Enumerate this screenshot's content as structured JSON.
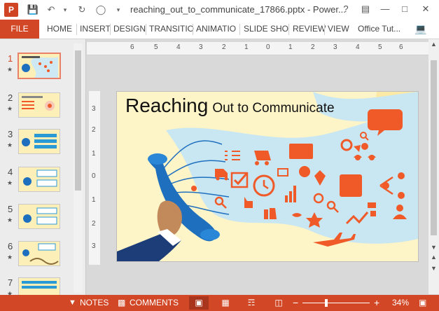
{
  "titlebar": {
    "app_icon": "P",
    "window_title": "reaching_out_to_communicate_17866.pptx - Power...",
    "help": "?",
    "minimize": "—",
    "restore": "□",
    "close": "✕"
  },
  "ribbon": {
    "file": "FILE",
    "tabs": [
      "HOME",
      "INSERT",
      "DESIGN",
      "TRANSITIO",
      "ANIMATIO",
      "SLIDE SHO",
      "REVIEW",
      "VIEW"
    ],
    "account": "Office Tut..."
  },
  "thumbnails": [
    {
      "num": "1",
      "star": "★"
    },
    {
      "num": "2",
      "star": "★"
    },
    {
      "num": "3",
      "star": "★"
    },
    {
      "num": "4",
      "star": "★"
    },
    {
      "num": "5",
      "star": "★"
    },
    {
      "num": "6",
      "star": "★"
    },
    {
      "num": "7",
      "star": "★"
    }
  ],
  "ruler": {
    "horizontal": [
      "6",
      "5",
      "4",
      "3",
      "2",
      "1",
      "0",
      "1",
      "2",
      "3",
      "4",
      "5",
      "6"
    ],
    "vertical": [
      "3",
      "2",
      "1",
      "0",
      "1",
      "2",
      "3"
    ]
  },
  "slide": {
    "title_big": "Reaching",
    "title_small": "Out to Communicate"
  },
  "statusbar": {
    "notes": "NOTES",
    "comments": "COMMENTS",
    "zoom_minus": "−",
    "zoom_plus": "+",
    "zoom": "34%"
  },
  "colors": {
    "accent": "#d24726",
    "icon_orange": "#ef5a28",
    "phone_blue": "#1f6fbf",
    "slide_bg": "#fdf4c7",
    "wave_blue": "#c9e7f2"
  }
}
